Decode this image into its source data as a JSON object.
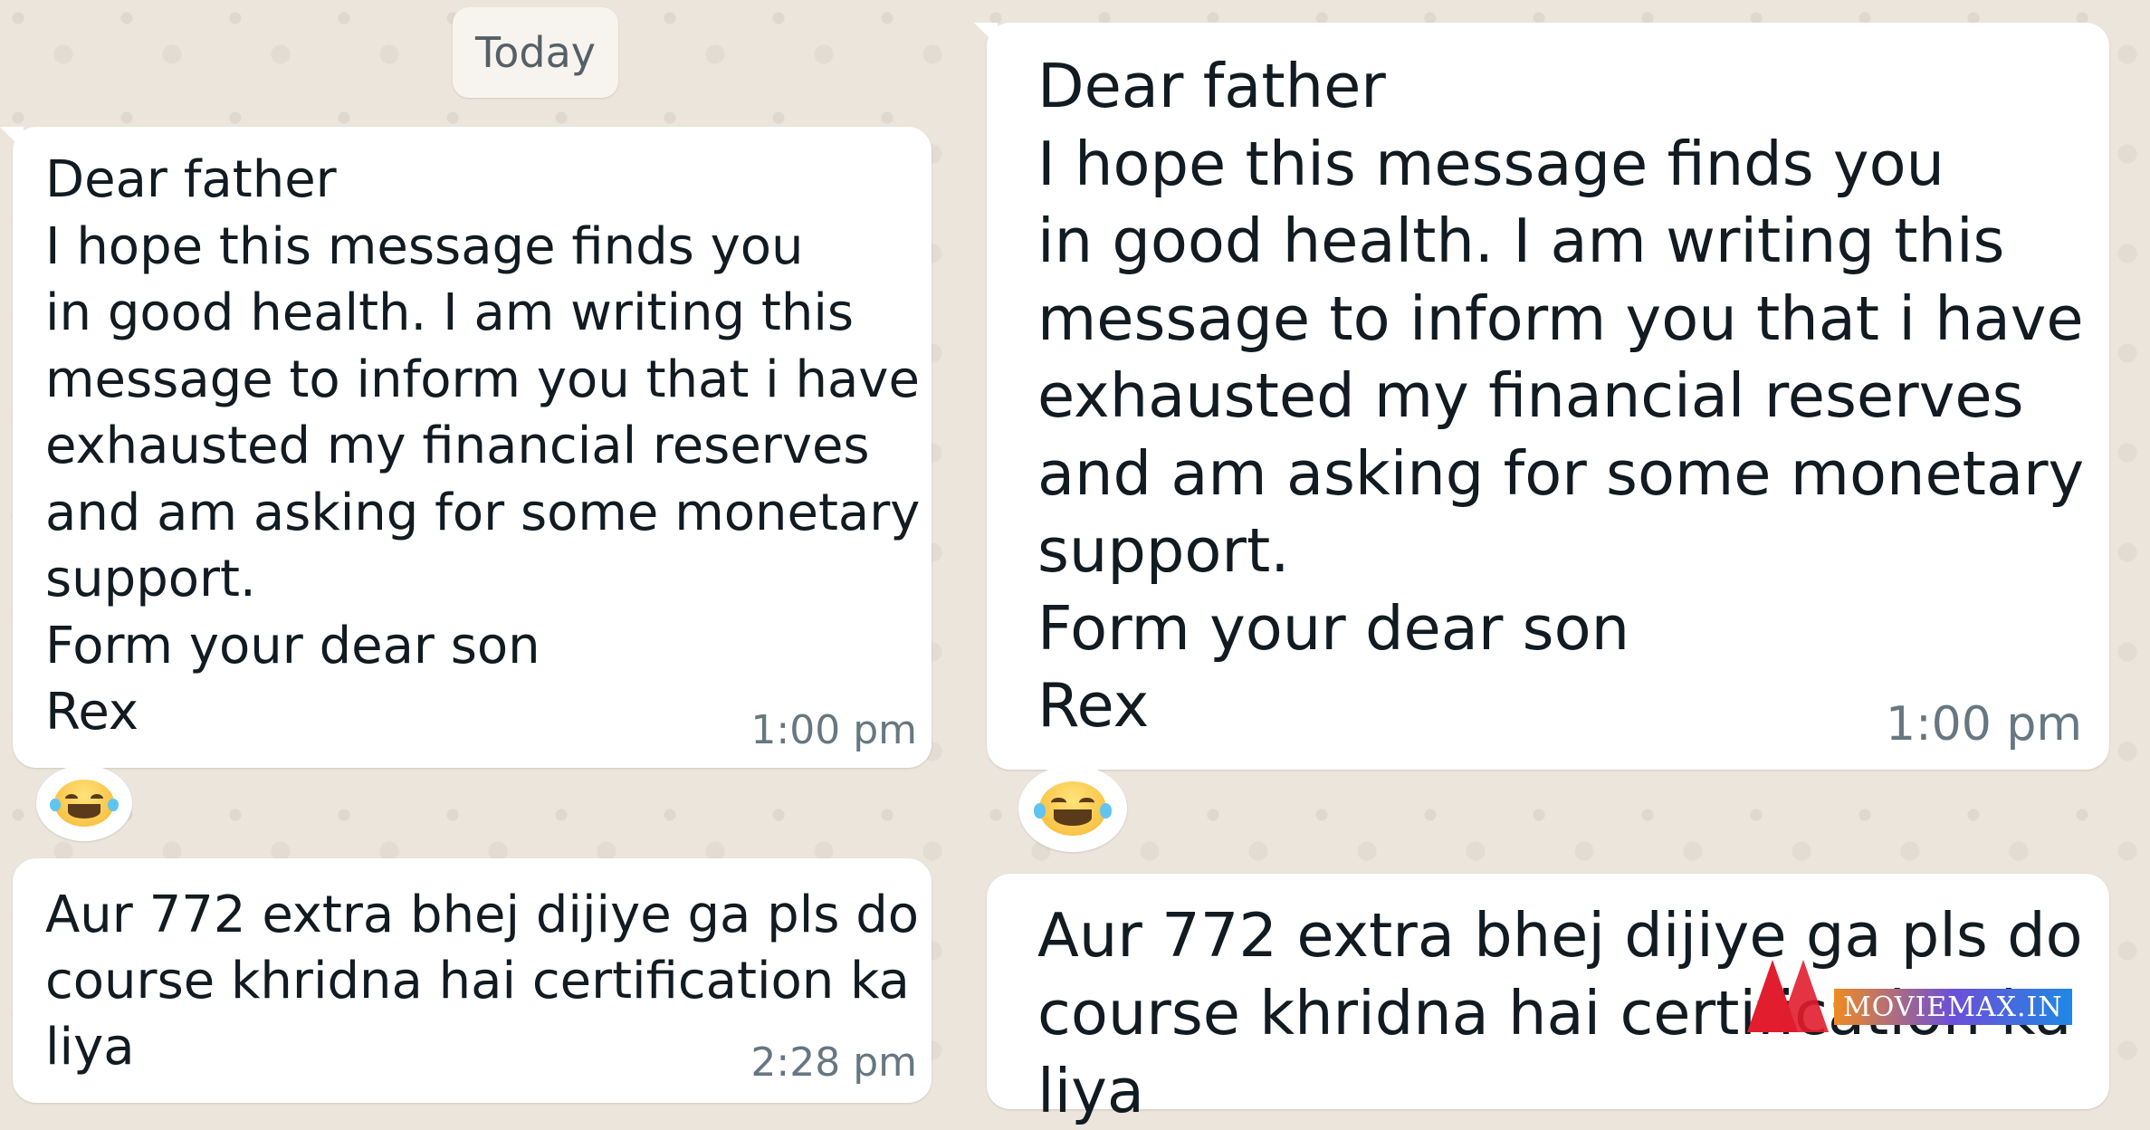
{
  "date_chip": "Today",
  "left_panel": {
    "message_1": {
      "lines": [
        "Dear father",
        "I hope this message finds you",
        "in good health. I am writing this",
        "message to inform you that i have",
        "exhausted my financial reserves",
        "and am asking for some monetary",
        "support.",
        "Form your dear son",
        "Rex"
      ],
      "time": "1:00 pm",
      "reaction": "😂"
    },
    "message_2": {
      "lines": [
        "Aur 772 extra bhej dijiye ga pls do",
        "course khridna hai certification ka",
        "liya"
      ],
      "time": "2:28 pm"
    }
  },
  "right_panel": {
    "message_1": {
      "lines": [
        "Dear father",
        "I hope this message finds you",
        "in good health. I am writing this",
        "message to inform you that i have",
        "exhausted my financial reserves",
        "and am asking for some monetary",
        "support.",
        "Form your dear son",
        "Rex"
      ],
      "time": "1:00 pm",
      "reaction": "😂"
    },
    "message_2": {
      "lines": [
        "Aur 772 extra bhej dijiye ga pls do",
        "course khridna hai certification ka",
        "liya"
      ]
    }
  },
  "watermark": "MOVIEMAX.IN",
  "colors": {
    "chat_background": "#ece5dc",
    "bubble": "#ffffff",
    "text": "#111b21",
    "timestamp": "#667781"
  }
}
